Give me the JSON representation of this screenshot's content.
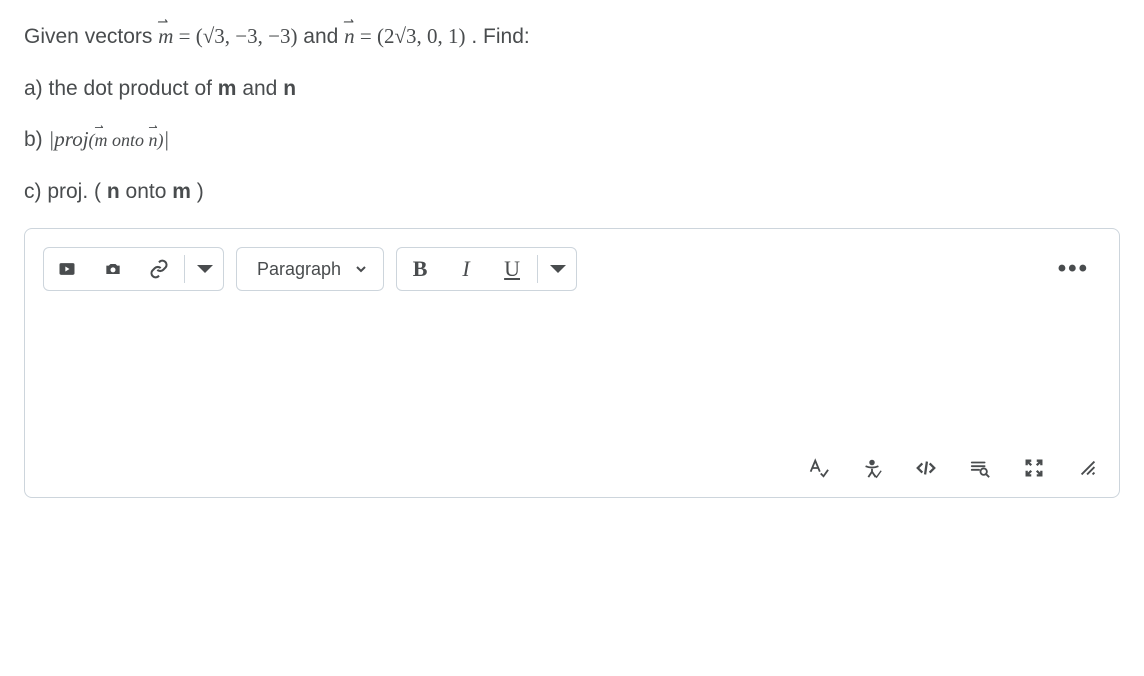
{
  "question": {
    "intro_prefix": "Given vectors ",
    "m_expr": "m⃗ = (√3, −3, −3)",
    "intro_middle": "  and  ",
    "n_expr": "n⃗ = (2√3, 0, 1)",
    "intro_suffix": ". Find:",
    "part_a_prefix": "a) the dot product of ",
    "part_a_m": "m",
    "part_a_and": " and ",
    "part_a_n": "n",
    "part_b_prefix": "b) ",
    "part_b_expr": "|proj(m⃗ onto n⃗)|",
    "part_c_prefix": "c) proj. (",
    "part_c_n": "n",
    "part_c_middle": "  onto ",
    "part_c_m": "m",
    "part_c_suffix": ")"
  },
  "editor": {
    "paragraph_label": "Paragraph",
    "bold_label": "B",
    "italic_label": "I",
    "underline_label": "U",
    "more_label": "•••"
  }
}
